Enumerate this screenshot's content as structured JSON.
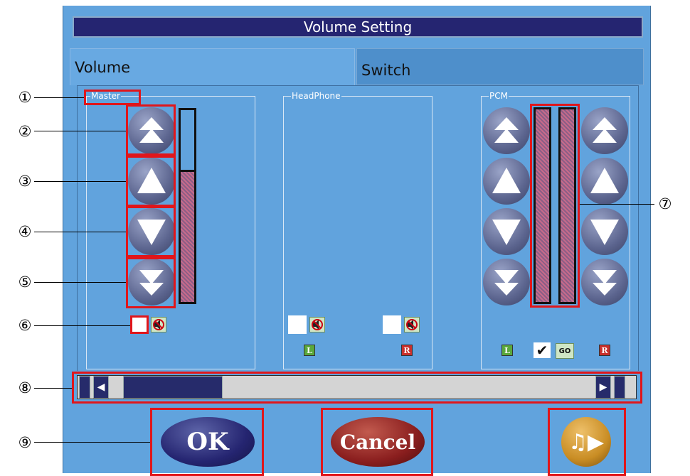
{
  "window": {
    "title": "Volume Setting"
  },
  "tabs": [
    {
      "label": "Volume"
    },
    {
      "label": "Switch"
    }
  ],
  "groups": {
    "master": {
      "label": "Master"
    },
    "headphone": {
      "label": "HeadPhone"
    },
    "pcm": {
      "label": "PCM"
    }
  },
  "channel_marks": {
    "left": "L",
    "right": "R",
    "check": "✔",
    "link": "GO"
  },
  "scrollbar": {
    "left_arrow": "◀",
    "right_arrow": "▶"
  },
  "buttons": {
    "ok": "OK",
    "cancel": "Cancel",
    "play": "♫▶"
  },
  "callouts": [
    "①",
    "②",
    "③",
    "④",
    "⑤",
    "⑥",
    "⑦",
    "⑧",
    "⑨"
  ],
  "levels": {
    "master": 0.69,
    "pcm_left": 1.0,
    "pcm_right": 1.0
  },
  "colors": {
    "title_bar": "#252571",
    "panel": "#61a3dd",
    "highlight": "#e0161b",
    "ok": "#252571",
    "cancel": "#8a1e1e",
    "play": "#c98d24"
  },
  "icons": [
    "double-up-arrow-icon",
    "up-arrow-icon",
    "down-arrow-icon",
    "double-down-arrow-icon",
    "mute-speaker-icon",
    "link-icon",
    "check-icon",
    "play-music-icon"
  ]
}
